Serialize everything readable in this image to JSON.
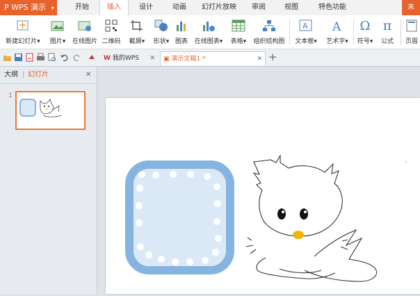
{
  "app": {
    "name": "WPS 演示"
  },
  "menu": {
    "tabs": [
      "开始",
      "插入",
      "设计",
      "动画",
      "幻灯片放映",
      "审阅",
      "视图",
      "特色功能"
    ],
    "active": "插入",
    "corner_label": "未"
  },
  "ribbon": {
    "buttons": [
      "新建幻灯片",
      "图片",
      "在线图片",
      "二维码",
      "截屏",
      "形状",
      "图表",
      "在线图表",
      "表格",
      "组织结构图",
      "文本框",
      "艺术字",
      "符号",
      "公式",
      "页眉"
    ]
  },
  "doc_tabs": [
    {
      "label": "我的WPS",
      "active": false
    },
    {
      "label": "演示文稿1 *",
      "active": true
    }
  ],
  "left_panel": {
    "tabs": [
      "大纲",
      "幻灯片"
    ],
    "active_tab": "幻灯片",
    "slide_number": "1"
  },
  "colors": {
    "accent": "#e8622a",
    "frame_blue": "#86b4e0",
    "frame_fill": "#dbe9f7"
  },
  "icons": [
    "close-icon",
    "add-tab-icon",
    "new-slide-icon",
    "picture-icon",
    "qrcode-icon",
    "shape-icon",
    "chart-icon",
    "table-icon",
    "textbox-icon",
    "omega-icon",
    "pi-icon"
  ]
}
